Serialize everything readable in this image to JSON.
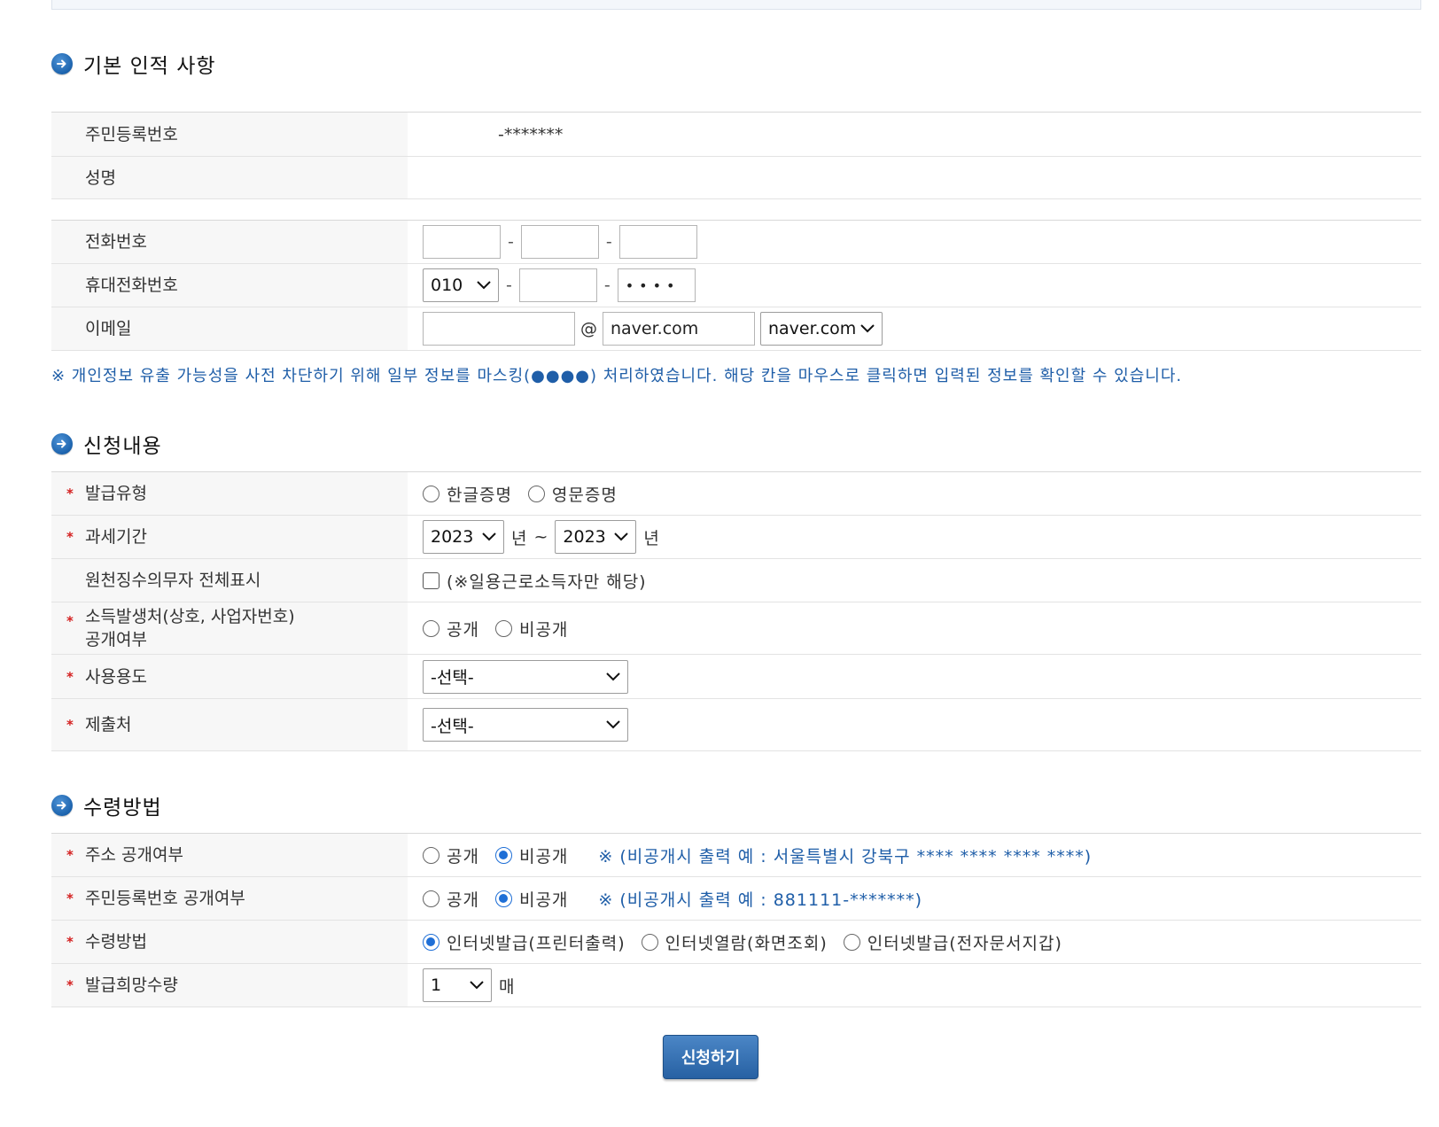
{
  "sections": {
    "basic": {
      "title": "기본 인적 사항"
    },
    "application": {
      "title": "신청내용"
    },
    "receipt": {
      "title": "수령방법"
    }
  },
  "basic_info": {
    "rrn_label": "주민등록번호",
    "rrn_value": "-*******",
    "name_label": "성명",
    "name_value": "",
    "phone_label": "전화번호",
    "phone_parts": [
      "",
      "",
      ""
    ],
    "mobile_label": "휴대전화번호",
    "mobile_prefix": "010",
    "mobile_middle": "",
    "mobile_last": "••••",
    "email_label": "이메일",
    "email_id": "",
    "email_at": "@",
    "email_domain": "naver.com",
    "email_domain_select": "naver.com",
    "dash": "-"
  },
  "notice": "※ 개인정보 유출 가능성을 사전 차단하기 위해 일부 정보를 마스킹(●●●●) 처리하였습니다. 해당 칸을 마우스로 클릭하면 입력된 정보를 확인할 수 있습니다.",
  "application": {
    "issue_type_label": "발급유형",
    "issue_type_options": [
      "한글증명",
      "영문증명"
    ],
    "tax_period_label": "과세기간",
    "tax_from": "2023",
    "tax_to": "2023",
    "year_unit": "년",
    "tilde": "~",
    "withholding_label": "원천징수의무자 전체표시",
    "withholding_note": "(※일용근로소득자만 해당)",
    "income_source_label_line1": "소득발생처(상호, 사업자번호)",
    "income_source_label_line2": "공개여부",
    "income_source_options": [
      "공개",
      "비공개"
    ],
    "usage_label": "사용용도",
    "usage_value": "-선택-",
    "submit_to_label": "제출처",
    "submit_to_value": "-선택-"
  },
  "receipt": {
    "address_label": "주소 공개여부",
    "address_options": [
      "공개",
      "비공개"
    ],
    "address_note": "※ (비공개시 출력 예 : 서울특별시 강북구 **** **** **** ****)",
    "rrn_label": "주민등록번호 공개여부",
    "rrn_options": [
      "공개",
      "비공개"
    ],
    "rrn_note": "※ (비공개시 출력 예 : 881111-*******)",
    "method_label": "수령방법",
    "method_options": [
      "인터넷발급(프린터출력)",
      "인터넷열람(화면조회)",
      "인터넷발급(전자문서지갑)"
    ],
    "qty_label": "발급희망수량",
    "qty_value": "1",
    "qty_unit": "매"
  },
  "required_mark": "*",
  "submit_label": "신청하기",
  "colors": {
    "accent": "#1f5ea8",
    "button": "#2f6cb0",
    "required": "#d42020",
    "radio_selected": "#1f6fd6"
  }
}
